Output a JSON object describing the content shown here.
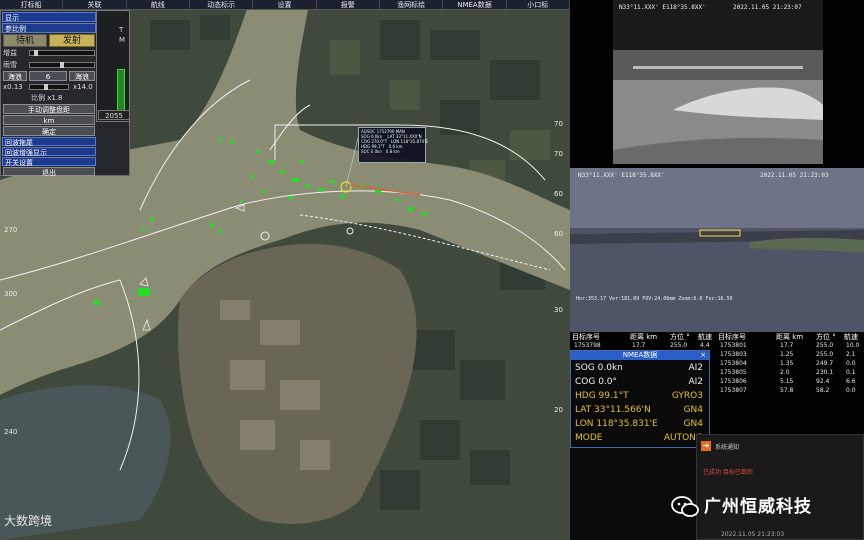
{
  "menu": [
    "打标船",
    "关联",
    "航线",
    "动态标示",
    "设置",
    "报警",
    "渔网标绘",
    "NMEA数据",
    "小口标"
  ],
  "control": {
    "display_label": "显示",
    "ref_label": "参比例",
    "standby_label": "待机",
    "transmit_label": "发射",
    "gain_label": "增益",
    "rain_label": "雨雪",
    "sea_label": "海浪",
    "sea_value": "6",
    "range_min": "x0.13",
    "range_max": "x14.0",
    "scale_label": "比例 x1.8",
    "nav_label": "手动调整盘距",
    "unit": "km",
    "confirm_label": "确定",
    "item1": "回波拖尾",
    "item2": "回波增强显示",
    "item3": "开关设置",
    "exit_label": "退出",
    "tm_label": "T\nM",
    "counter": "2055"
  },
  "map_labels": [
    "270",
    "300",
    "240",
    "70",
    "70",
    "60",
    "60",
    "30",
    "20"
  ],
  "target_tip": "ADSOC 1752790 MAN\nSOG 0.0kn    LAT 33°11.XXX'N\nCOG 270.0°T   LON 118°35.87X'E\nHDG 99.1°T   0.6 km\nSOC 0.0kn   0.8 km",
  "cam1": {
    "info": "N33°11.XXX' E118°35.8XX'",
    "time": "2022.11.05 21:23:07"
  },
  "cam2": {
    "info": "N33°11.XXX' E118°35.8XX'",
    "time": "2022.11.05 21:23:03",
    "bottom": "Hor:353.17 Ver:181.09 FOV:24.06mm Zoom:6.0 Foc:16.50"
  },
  "table": {
    "headers": [
      "目标序号",
      "距离 km",
      "方位 °",
      "航速"
    ],
    "headers2": [
      "目标序号",
      "距离 km",
      "方位 °",
      "航速"
    ],
    "left_rows": [
      {
        "id": "1753798",
        "dist": "17.7",
        "brg": "255.0",
        "spd": "4.4"
      }
    ],
    "right_rows": [
      {
        "id": "1753801",
        "dist": "17.7",
        "brg": "255.0",
        "spd": "10.0"
      },
      {
        "id": "1753803",
        "dist": "1.25",
        "brg": "255.0",
        "spd": "2.1"
      },
      {
        "id": "1753804",
        "dist": "1.35",
        "brg": "249.7",
        "spd": "0.0"
      },
      {
        "id": "1753805",
        "dist": "2.0",
        "brg": "230.1",
        "spd": "0.1"
      },
      {
        "id": "1753806",
        "dist": "5.15",
        "brg": "92.4",
        "spd": "6.6"
      },
      {
        "id": "1753807",
        "dist": "57.8",
        "brg": "58.2",
        "spd": "0.0"
      }
    ]
  },
  "nmea": {
    "title": "NMEA数据",
    "close": "×",
    "rows": [
      {
        "k": "SOG 0.0kn",
        "v": "AI2"
      },
      {
        "k": "COG 0.0°",
        "v": "AI2"
      },
      {
        "k": "HDG 99.1°T",
        "v": "GYRO3"
      },
      {
        "k": "LAT 33°11.566'N",
        "v": "GN4"
      },
      {
        "k": "LON 118°35.831'E",
        "v": "GN4"
      },
      {
        "k": "MODE",
        "v": "AUTONO"
      }
    ]
  },
  "notify": {
    "title": "系统通知",
    "sub": "已成功  目标已跟踪",
    "time": "2022.11.05 21:23:03"
  },
  "brand": "广州恒威科技",
  "watermark": "大数跨境"
}
